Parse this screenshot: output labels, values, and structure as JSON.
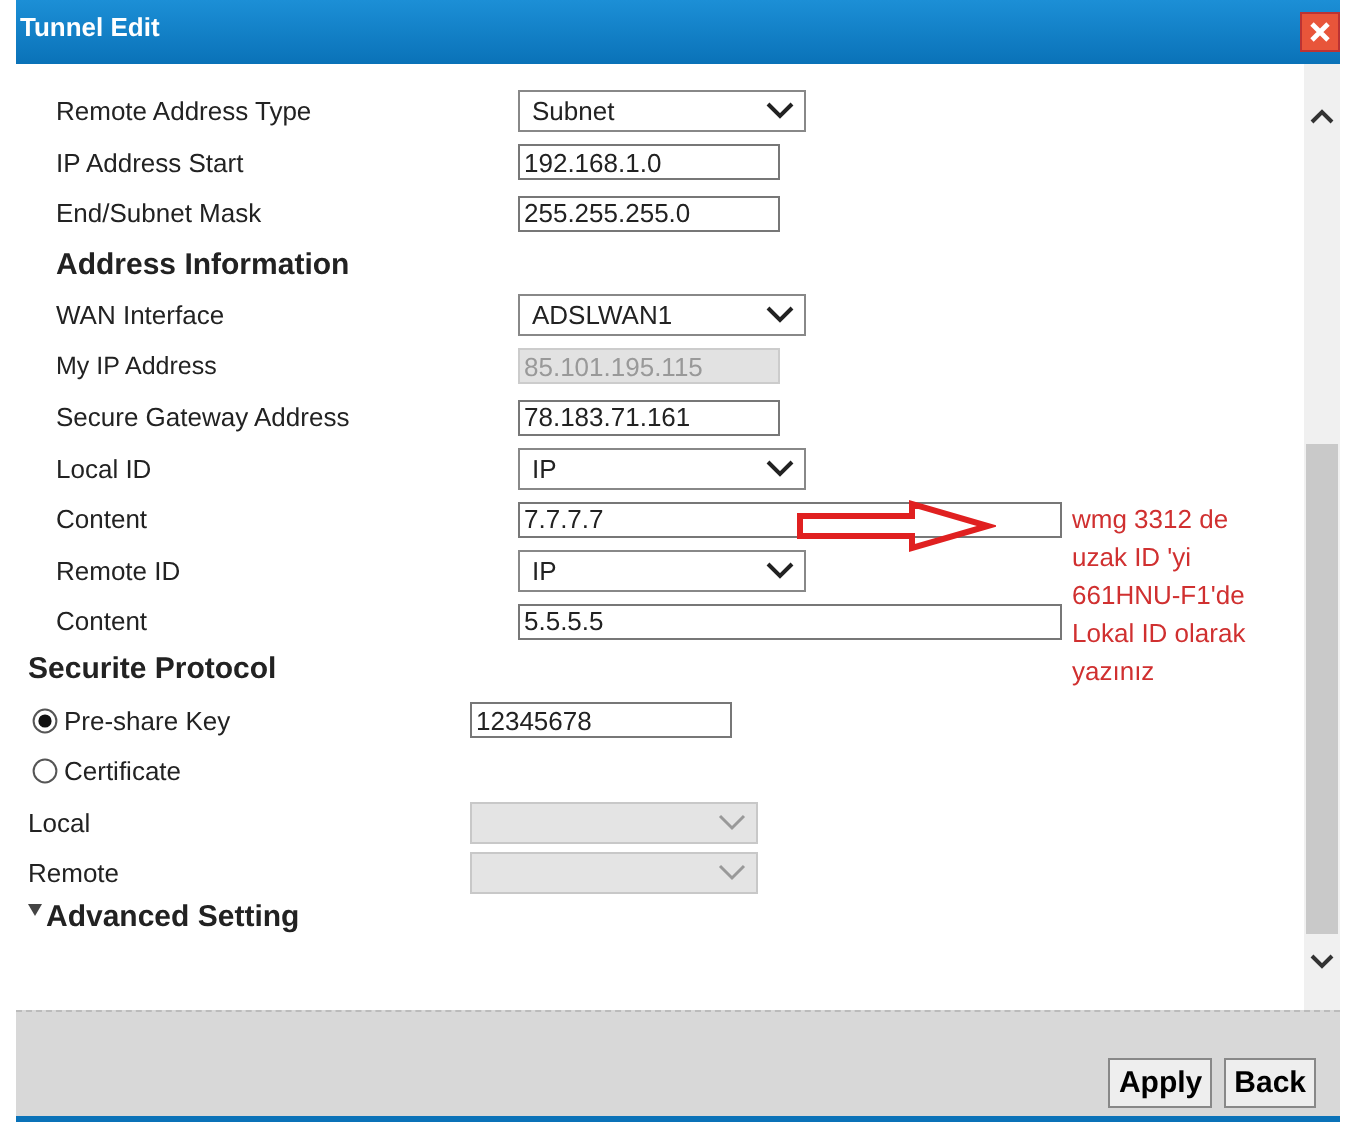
{
  "window": {
    "title": "Tunnel Edit"
  },
  "rows": [
    {
      "kind": "select",
      "label": "Remote Address Type",
      "value": "Subnet"
    },
    {
      "kind": "input",
      "label": "IP Address Start",
      "value": "192.168.1.0"
    },
    {
      "kind": "input",
      "label": "End/Subnet Mask",
      "value": "255.255.255.0"
    },
    {
      "kind": "heading",
      "label": "Address Information"
    },
    {
      "kind": "select",
      "label": "WAN Interface",
      "value": "ADSLWAN1"
    },
    {
      "kind": "input",
      "label": "My IP Address",
      "value": "85.101.195.115",
      "disabled": true
    },
    {
      "kind": "input",
      "label": "Secure Gateway Address",
      "value": "78.183.71.161"
    },
    {
      "kind": "select",
      "label": "Local ID",
      "value": "IP"
    },
    {
      "kind": "wide-input",
      "label": "Content",
      "value": "7.7.7.7"
    },
    {
      "kind": "select",
      "label": "Remote ID",
      "value": "IP"
    },
    {
      "kind": "wide-input",
      "label": "Content",
      "value": "5.5.5.5"
    }
  ],
  "protocol": {
    "title": "Securite Protocol",
    "options": [
      {
        "label": "Pre-share Key",
        "selected": true,
        "value": "12345678"
      },
      {
        "label": "Certificate",
        "selected": false
      }
    ],
    "selects": [
      {
        "label": "Local",
        "disabled": true
      },
      {
        "label": "Remote",
        "disabled": true
      }
    ]
  },
  "advanced": {
    "label": "Advanced Setting"
  },
  "annotation": {
    "text": "wmg 3312 de uzak ID 'yi 661HNU-F1'de Lokal ID olarak yazınız"
  },
  "buttons": [
    "Apply",
    "Back"
  ]
}
